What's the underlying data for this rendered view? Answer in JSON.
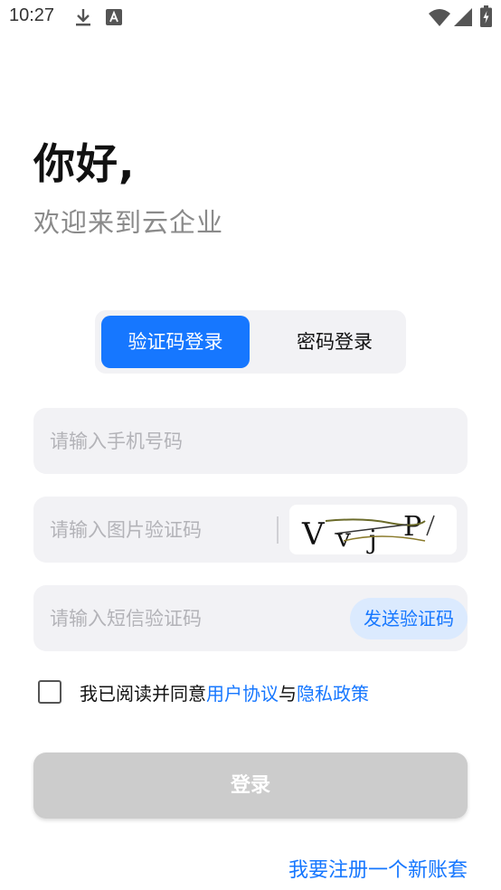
{
  "status_bar": {
    "time": "10:27",
    "icons": [
      "download-icon",
      "a-font-icon",
      "wifi-icon",
      "signal-icon",
      "battery-icon"
    ]
  },
  "greeting": {
    "title": "你好,",
    "subtitle": "欢迎来到云企业"
  },
  "tabs": [
    {
      "label": "验证码登录",
      "active": true
    },
    {
      "label": "密码登录",
      "active": false
    }
  ],
  "form": {
    "phone_placeholder": "请输入手机号码",
    "captcha_placeholder": "请输入图片验证码",
    "captcha_text": "VvjP",
    "sms_placeholder": "请输入短信验证码",
    "send_code_label": "发送验证码"
  },
  "agreement": {
    "prefix": "我已阅读并同意",
    "user_agreement": "用户协议",
    "connector": "与",
    "privacy_policy": "隐私政策"
  },
  "login_label": "登录",
  "register_label": "我要注册一个新账套",
  "colors": {
    "accent": "#1677ff",
    "field_bg": "#f2f2f5",
    "disabled_button": "#cccccc"
  }
}
